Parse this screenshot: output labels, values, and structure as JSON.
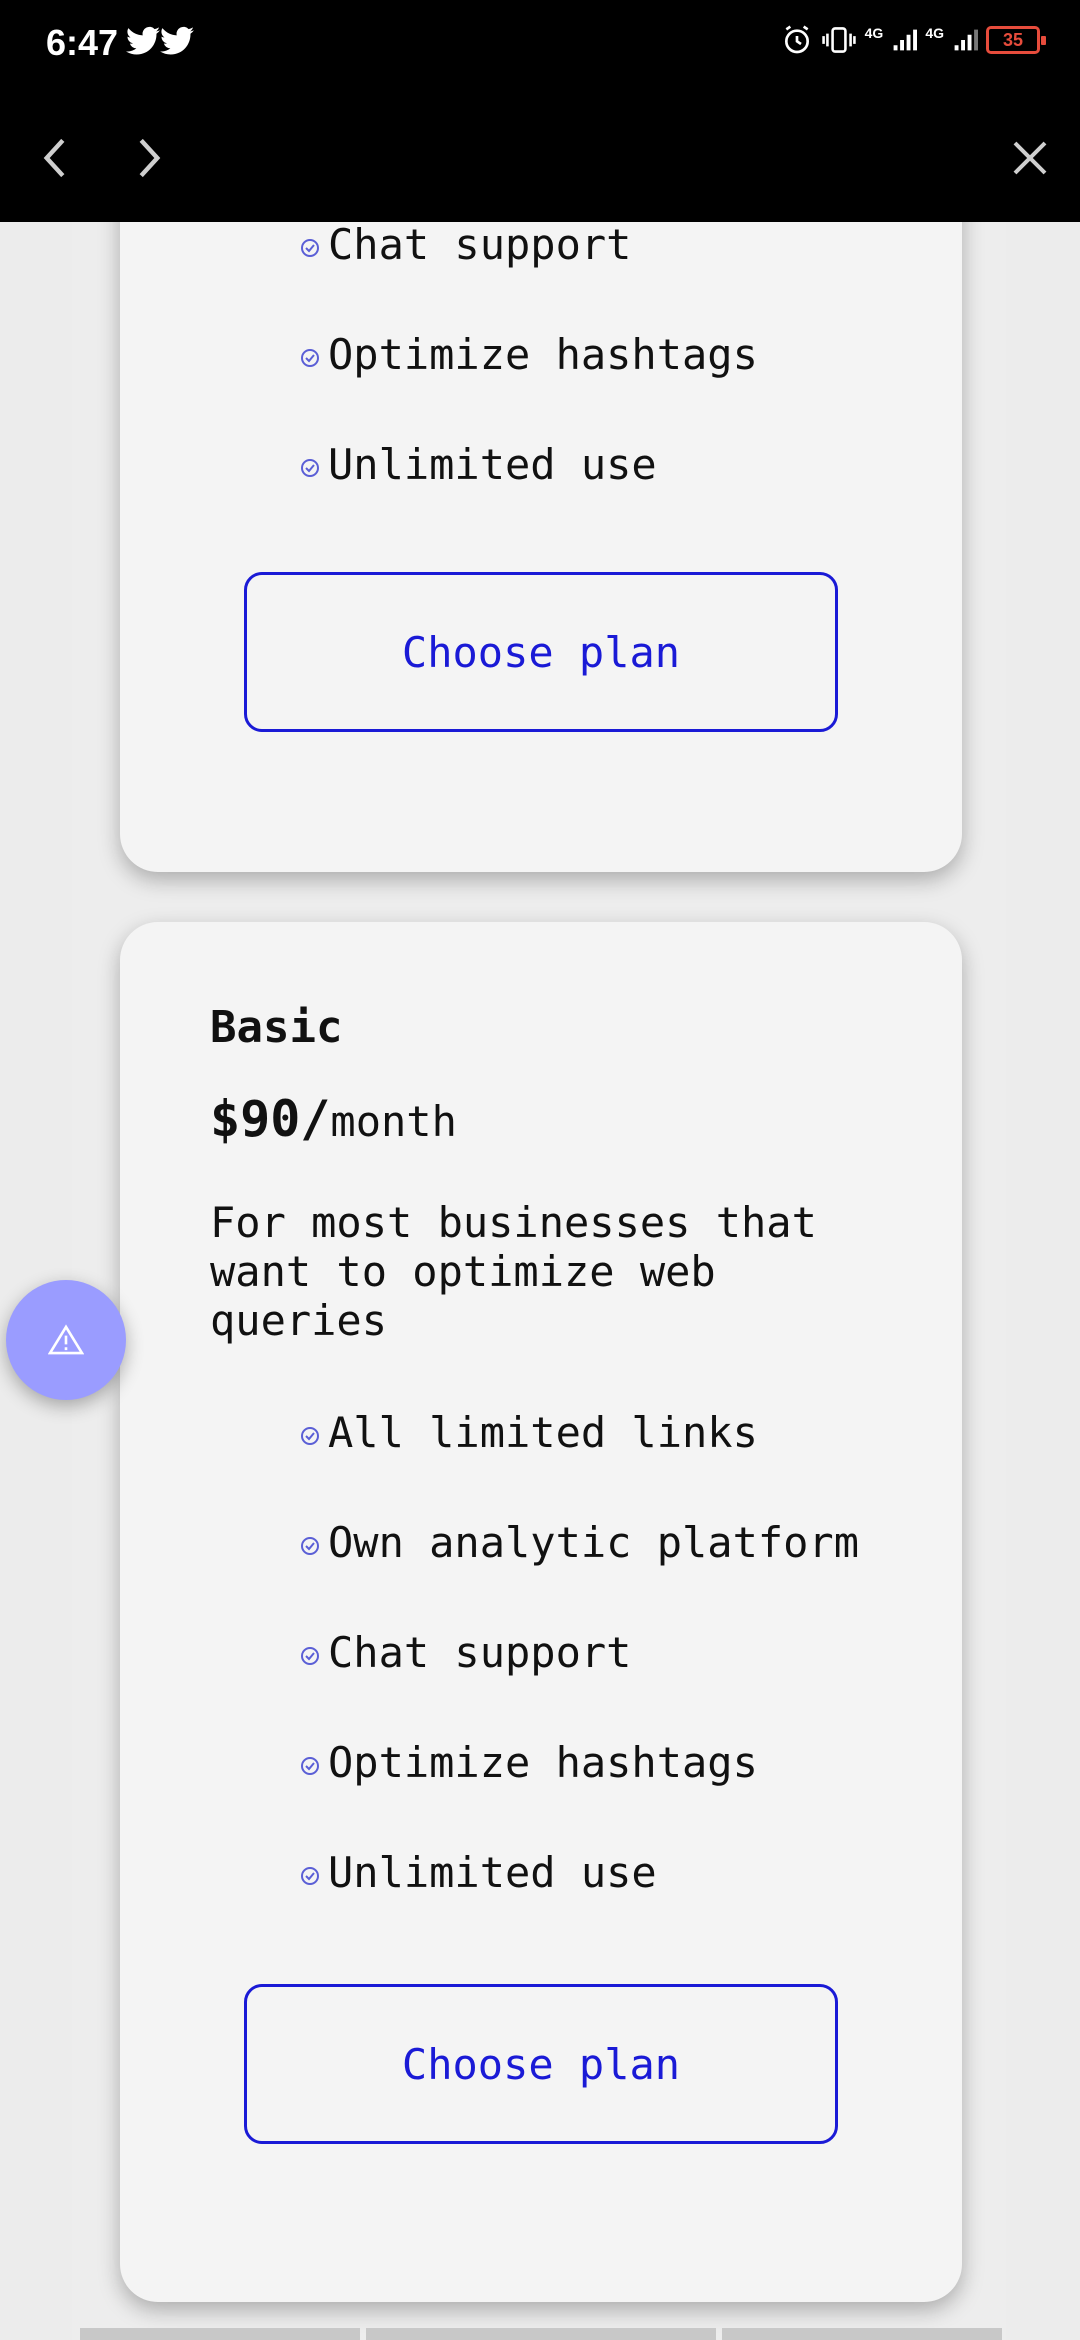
{
  "status_bar": {
    "time": "6:47",
    "network_label_1": "4G",
    "network_label_2": "4G",
    "battery": "35"
  },
  "nav": {
    "back_icon": "chevron-left-icon",
    "forward_icon": "chevron-right-icon",
    "close_icon": "close-icon"
  },
  "top_card": {
    "features": [
      "Chat support",
      "Optimize hashtags",
      "Unlimited use"
    ],
    "button_label": "Choose plan"
  },
  "basic_card": {
    "name": "Basic",
    "price": "$90/",
    "period": "month",
    "description": "For most businesses that want to optimize web queries",
    "features": [
      "All limited links",
      "Own analytic platform",
      "Chat support",
      "Optimize hashtags",
      "Unlimited use"
    ],
    "button_label": "Choose plan"
  },
  "colors": {
    "accent": "#1a1ad6",
    "fab": "#9a9cff",
    "battery": "#e74c3c"
  }
}
